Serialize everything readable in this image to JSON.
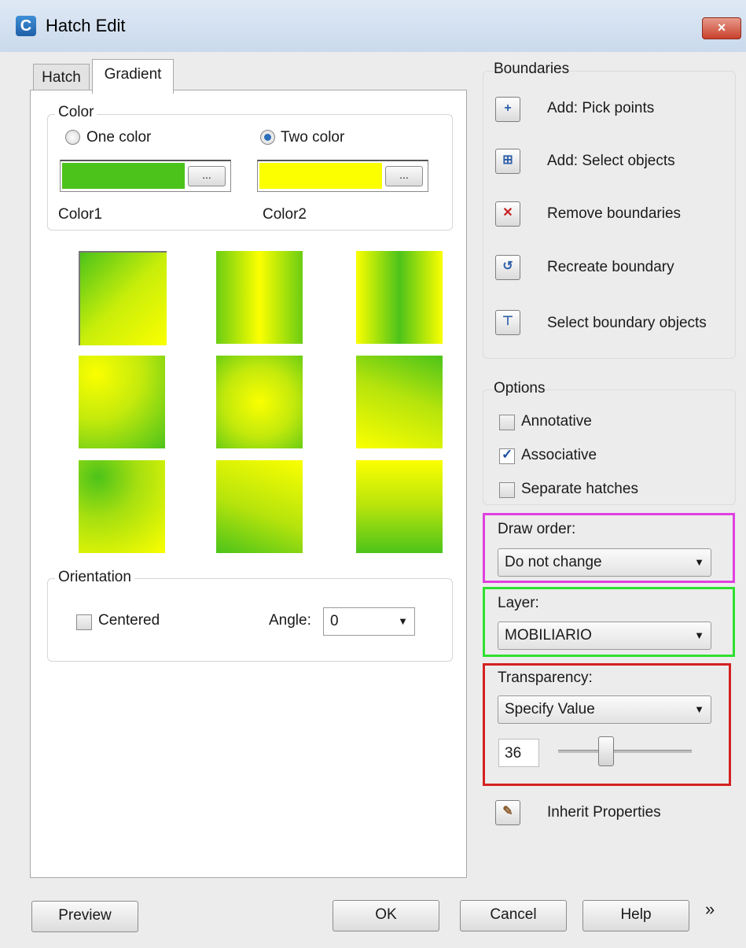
{
  "window": {
    "title": "Hatch Edit",
    "close_glyph": "×"
  },
  "tabs": [
    {
      "label": "Hatch",
      "active": false
    },
    {
      "label": "Gradient",
      "active": true
    }
  ],
  "color_group": {
    "legend": "Color",
    "one_color_label": "One color",
    "two_color_label": "Two color",
    "selected": "Two color",
    "color1": {
      "label": "Color1",
      "hex": "#4cc31a"
    },
    "color2": {
      "label": "Color2",
      "hex": "#fbff00"
    },
    "dots_label": "..."
  },
  "gradient_patterns": 9,
  "orientation": {
    "legend": "Orientation",
    "centered_label": "Centered",
    "centered_checked": false,
    "angle_label": "Angle:",
    "angle_value": "0"
  },
  "boundaries": {
    "legend": "Boundaries",
    "items": [
      {
        "label": "Add: Pick points",
        "icon": "pick-points-icon"
      },
      {
        "label": "Add: Select objects",
        "icon": "select-objects-icon"
      },
      {
        "label": "Remove boundaries",
        "icon": "remove-boundaries-icon"
      },
      {
        "label": "Recreate boundary",
        "icon": "recreate-boundary-icon"
      },
      {
        "label": "Select boundary objects",
        "icon": "select-boundary-objects-icon"
      }
    ]
  },
  "options": {
    "legend": "Options",
    "annotative_label": "Annotative",
    "annotative_checked": false,
    "associative_label": "Associative",
    "associative_checked": true,
    "separate_label": "Separate hatches",
    "separate_checked": false
  },
  "draw_order": {
    "label": "Draw order:",
    "value": "Do not change"
  },
  "layer": {
    "label": "Layer:",
    "value": "MOBILIARIO"
  },
  "transparency": {
    "label": "Transparency:",
    "mode": "Specify Value",
    "value": "36",
    "slider_fraction": 0.36
  },
  "inherit": {
    "label": "Inherit Properties"
  },
  "buttons": {
    "preview": "Preview",
    "ok": "OK",
    "cancel": "Cancel",
    "help": "Help",
    "more": "»"
  },
  "highlight_colors": {
    "draw_order": "#e040e0",
    "layer": "#2fe02f",
    "transparency": "#d42121"
  }
}
